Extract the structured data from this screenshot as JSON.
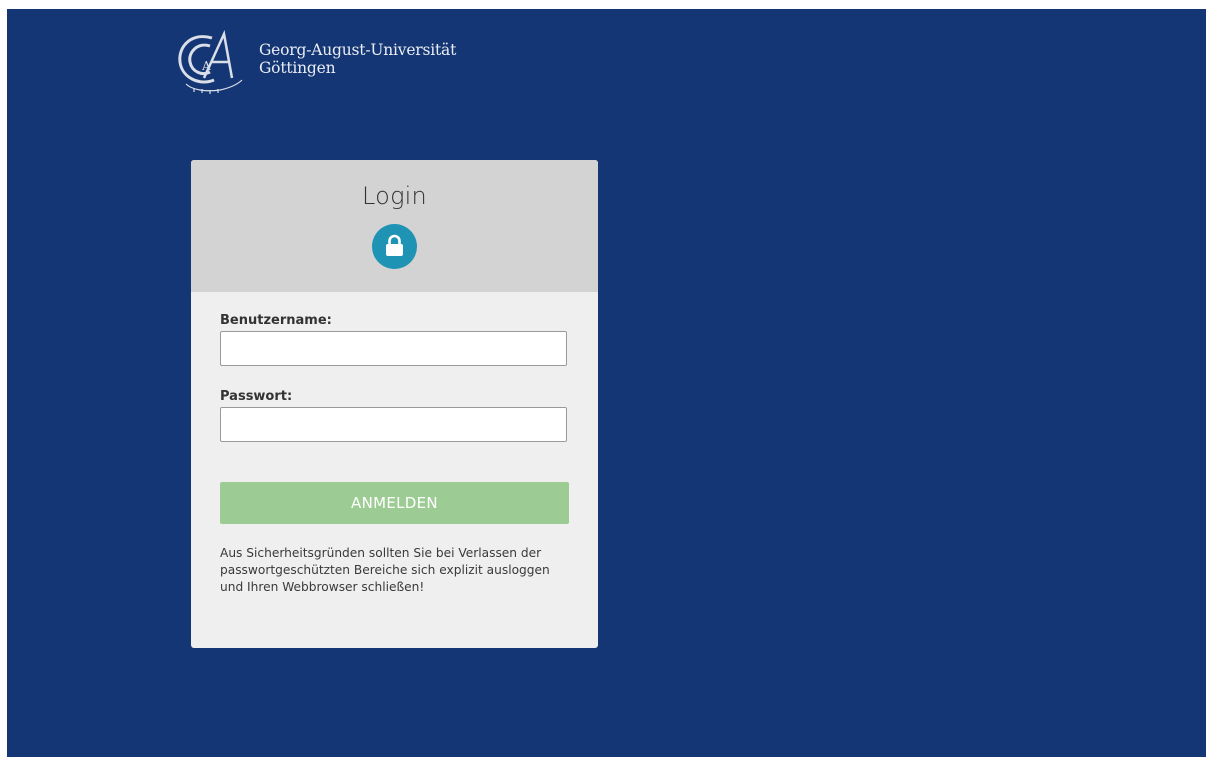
{
  "header": {
    "university_line1": "Georg-August-Universität",
    "university_line2": "Göttingen",
    "logo_icon": "university-seal-logo"
  },
  "login_card": {
    "title": "Login",
    "badge_icon": "lock-icon",
    "username_label": "Benutzername:",
    "username_value": "",
    "password_label": "Passwort:",
    "password_value": "",
    "submit_label": "ANMELDEN",
    "security_note": "Aus Sicherheitsgründen sollten Sie bei Verlassen der passwortgeschützten Bereiche sich explizit ausloggen und Ihren Webbrowser schließen!"
  },
  "colors": {
    "page_background": "#153674",
    "card_header": "#d3d3d3",
    "card_body": "#efefef",
    "lock_badge": "#1f93b4",
    "submit_button": "#9ccc93"
  }
}
